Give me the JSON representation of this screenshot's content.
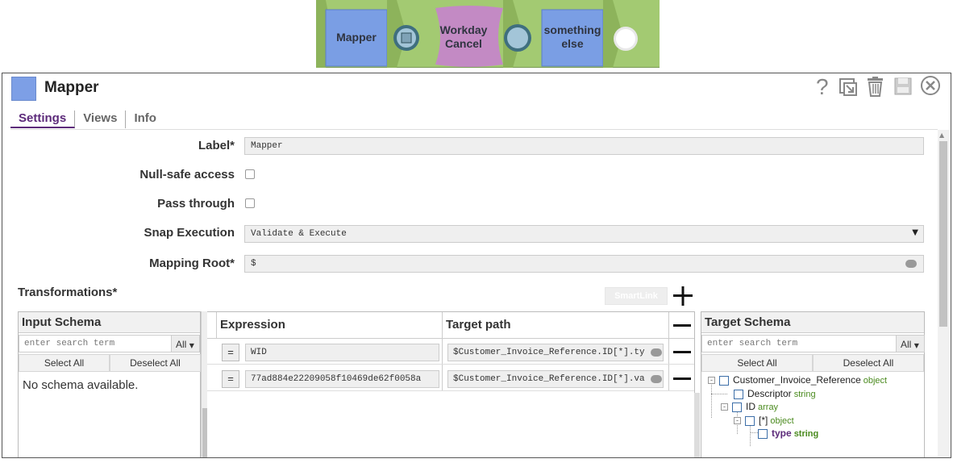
{
  "pipeline": {
    "snaps": [
      {
        "label_lines": [
          "Mapper"
        ],
        "color": "#7a9ee4"
      },
      {
        "label_lines": [
          "Workday",
          "Cancel"
        ],
        "color": "#c38ac4"
      },
      {
        "label_lines": [
          "something",
          "else"
        ],
        "color": "#7a9ee4"
      }
    ],
    "background": "#a3ca72"
  },
  "dialog": {
    "title": "Mapper",
    "icon_color": "#7d9fe6",
    "toolbar": [
      {
        "icon": "help-icon",
        "glyph": "?"
      },
      {
        "icon": "copy-icon"
      },
      {
        "icon": "trash-icon"
      },
      {
        "icon": "save-icon"
      },
      {
        "icon": "close-icon",
        "glyph": "⊗"
      }
    ],
    "tabs": [
      {
        "label": "Settings",
        "active": true
      },
      {
        "label": "Views",
        "active": false
      },
      {
        "label": "Info",
        "active": false
      }
    ]
  },
  "settings": {
    "label": {
      "label": "Label*",
      "value": "Mapper"
    },
    "null_safe": {
      "label": "Null-safe access",
      "checked": false
    },
    "pass_through": {
      "label": "Pass through",
      "checked": false
    },
    "snap_execution": {
      "label": "Snap Execution",
      "value": "Validate & Execute"
    },
    "mapping_root": {
      "label": "Mapping Root*",
      "value": "$"
    }
  },
  "transformations": {
    "title": "Transformations*",
    "smartlink_label": "SmartLink",
    "add_glyph": "+",
    "input_schema": {
      "title": "Input Schema",
      "search_placeholder": "enter search term",
      "filter": "All",
      "select_all": "Select All",
      "deselect_all": "Deselect All",
      "empty_text": "No schema available."
    },
    "expression_header": "Expression",
    "target_path_header": "Target path",
    "rows": [
      {
        "eq": "=",
        "expression": "WID",
        "target": "$Customer_Invoice_Reference.ID[*].ty"
      },
      {
        "eq": "=",
        "expression": "77ad884e22209058f10469de62f0058a",
        "target": "$Customer_Invoice_Reference.ID[*].va"
      }
    ],
    "target_schema": {
      "title": "Target Schema",
      "search_placeholder": "enter search term",
      "filter": "All",
      "select_all": "Select All",
      "deselect_all": "Deselect All",
      "tree": [
        {
          "name": "Customer_Invoice_Reference",
          "type": "object",
          "toggle": "-"
        },
        {
          "name": "Descriptor",
          "type": "string",
          "toggle": ""
        },
        {
          "name": "ID",
          "type": "array",
          "toggle": "-"
        },
        {
          "name": "[*]",
          "type": "object",
          "toggle": "-"
        },
        {
          "name": "type",
          "type": "string",
          "toggle": "",
          "highlight": true
        }
      ]
    }
  },
  "colors": {
    "accent_tab": "#5c2a7a",
    "type_green": "#4a8a1e",
    "highlight_purple": "#5c2a7a"
  }
}
